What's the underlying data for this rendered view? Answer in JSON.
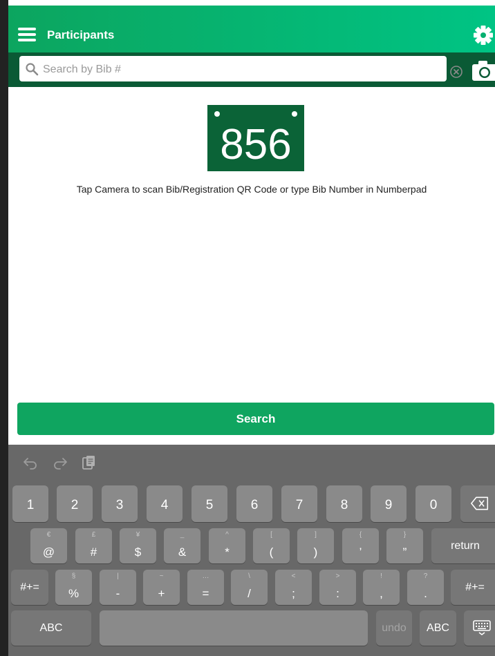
{
  "app": {
    "title": "Participants"
  },
  "search": {
    "placeholder": "Search by Bib #",
    "value": ""
  },
  "bib": {
    "number": "856"
  },
  "hint": "Tap Camera to scan Bib/Registration QR Code or type Bib Number in Numberpad",
  "search_button": "Search",
  "colors": {
    "header": "#0ca55f",
    "search_strip": "#0a5a35",
    "bib": "#0b6337",
    "button": "#0fa560",
    "keyboard": "#686868"
  },
  "keyboard": {
    "toolbar": [
      "undo-icon",
      "redo-icon",
      "paste-icon"
    ],
    "row1": [
      "1",
      "2",
      "3",
      "4",
      "5",
      "6",
      "7",
      "8",
      "9",
      "0"
    ],
    "row2": [
      {
        "main": "@",
        "sub": "€"
      },
      {
        "main": "#",
        "sub": "£"
      },
      {
        "main": "$",
        "sub": "¥"
      },
      {
        "main": "&",
        "sub": "_"
      },
      {
        "main": "*",
        "sub": "^"
      },
      {
        "main": "(",
        "sub": "["
      },
      {
        "main": ")",
        "sub": "]"
      },
      {
        "main": "’",
        "sub": "{"
      },
      {
        "main": "”",
        "sub": "}"
      }
    ],
    "return_label": "return",
    "row3": [
      {
        "main": "%",
        "sub": "§"
      },
      {
        "main": "-",
        "sub": "|"
      },
      {
        "main": "+",
        "sub": "~"
      },
      {
        "main": "=",
        "sub": "…"
      },
      {
        "main": "/",
        "sub": "\\"
      },
      {
        "main": ";",
        "sub": "<"
      },
      {
        "main": ":",
        "sub": ">"
      },
      {
        "main": ",",
        "sub": "!"
      },
      {
        "main": ".",
        "sub": "?"
      }
    ],
    "shift_label": "#+=",
    "abc_label": "ABC",
    "undo_label": "undo"
  }
}
